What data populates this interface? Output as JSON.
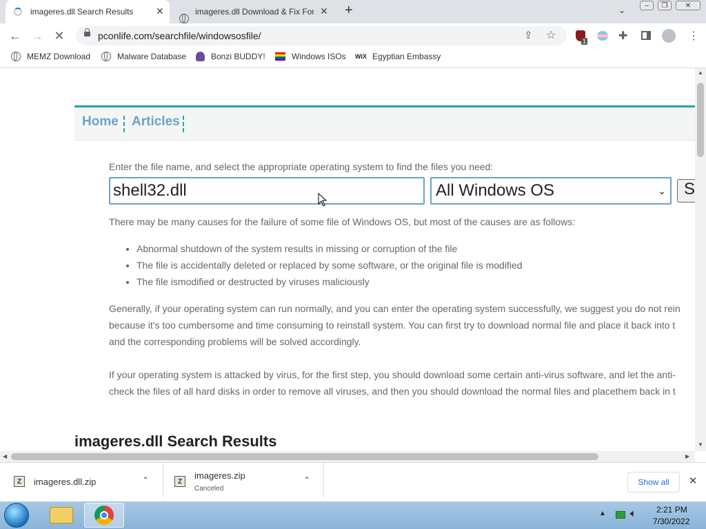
{
  "tabs": [
    {
      "title": "imageres.dll Search Results",
      "active": true
    },
    {
      "title": "imageres.dll Download & Fix For",
      "active": false
    }
  ],
  "toolbar": {
    "url": "pconlife.com/searchfile/windowsosfile/",
    "extension_badge": "1"
  },
  "bookmarks": [
    {
      "label": "MEMZ Download",
      "icon": "globe-icon"
    },
    {
      "label": "Malware Database",
      "icon": "globe-icon"
    },
    {
      "label": "Bonzi BUDDY!",
      "icon": "bonzi-icon"
    },
    {
      "label": "Windows ISOs",
      "icon": "rainbow-flag-icon"
    },
    {
      "label": "Egyptian Embassy",
      "icon": "wix-icon"
    }
  ],
  "site_nav": {
    "home": "Home",
    "articles": "Articles"
  },
  "search": {
    "hint": "Enter the file name, and select the appropriate operating system to find the files you need:",
    "value": "shell32.dll",
    "os_selected": "All Windows OS",
    "button": "S"
  },
  "content": {
    "intro": "There may be many causes for the failure of some file of Windows OS, but most of the causes are as follows:",
    "causes": [
      "Abnormal shutdown of the system results in missing or corruption of the file",
      "The file is accidentally deleted or replaced by some software, or the original file is modified",
      "The file ismodified or destructed by viruses maliciously"
    ],
    "para1": [
      "Generally, if your operating system can run normally, and you can enter the operating system successfully, we suggest you do not rein",
      "because it's too cumbersome and time consuming to reinstall system. You can first try to download normal file and place it back into t",
      "and the corresponding problems will be solved accordingly."
    ],
    "para2": [
      "If your operating system is attacked by virus, for the first step, you should download some certain anti-virus software, and let the anti-",
      "check the files of all hard disks in order to remove all viruses, and then you should download the normal files and placethem back in t"
    ],
    "results_heading": "imageres.dll Search Results"
  },
  "downloads": {
    "items": [
      {
        "name": "imageres.dll.zip",
        "status": ""
      },
      {
        "name": "imageres.zip",
        "status": "Canceled"
      }
    ],
    "show_all": "Show all"
  },
  "taskbar": {
    "time": "2:21 PM",
    "date": "7/30/2022"
  }
}
